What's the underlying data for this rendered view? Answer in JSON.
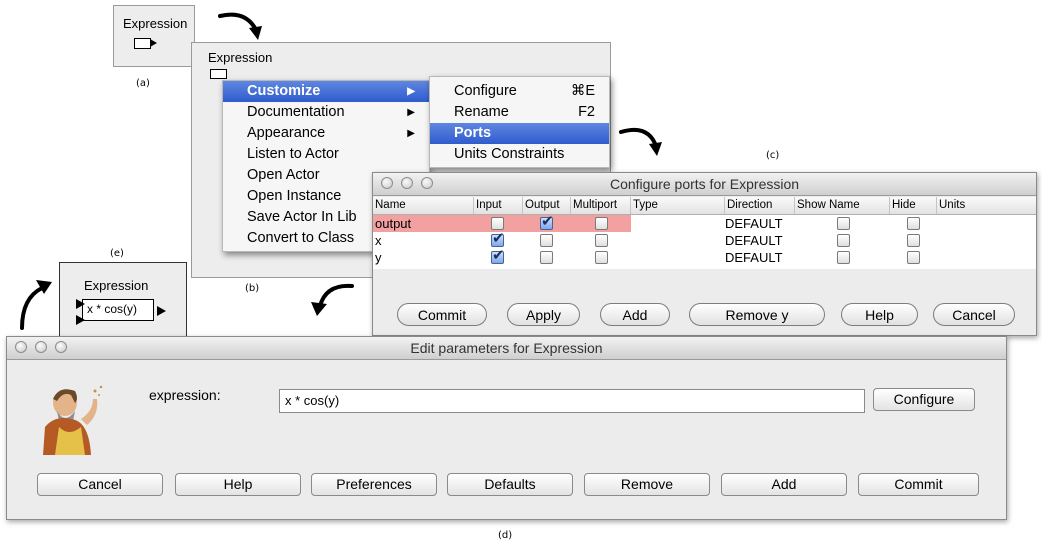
{
  "panel_a": {
    "title": "Expression",
    "caption": "(a)"
  },
  "panel_b": {
    "title": "Expression",
    "caption": "(b)",
    "menu": [
      {
        "label": "Customize",
        "submenu": true,
        "selected": true
      },
      {
        "label": "Documentation",
        "submenu": true
      },
      {
        "label": "Appearance",
        "submenu": true
      },
      {
        "label": "Listen to Actor"
      },
      {
        "label": "Open Actor"
      },
      {
        "label": "Open Instance"
      },
      {
        "label": "Save Actor In Lib"
      },
      {
        "label": "Convert to Class"
      }
    ],
    "submenu": [
      {
        "label": "Configure",
        "shortcut": "⌘E"
      },
      {
        "label": "Rename",
        "shortcut": "F2"
      },
      {
        "label": "Ports",
        "shortcut": "",
        "selected": true
      },
      {
        "label": "Units Constraints",
        "shortcut": ""
      }
    ]
  },
  "panel_c": {
    "caption": "(c)",
    "title": "Configure ports for Expression",
    "columns": [
      "Name",
      "Input",
      "Output",
      "Multiport",
      "Type",
      "Direction",
      "Show Name",
      "Hide",
      "Units"
    ],
    "rows": [
      {
        "name": "output",
        "input": false,
        "output": true,
        "multiport": false,
        "direction": "DEFAULT",
        "show_name": false,
        "hide": false,
        "highlight": true
      },
      {
        "name": "x",
        "input": true,
        "output": false,
        "multiport": false,
        "direction": "DEFAULT",
        "show_name": false,
        "hide": false
      },
      {
        "name": "y",
        "input": true,
        "output": false,
        "multiport": false,
        "direction": "DEFAULT",
        "show_name": false,
        "hide": false
      }
    ],
    "buttons": [
      "Commit",
      "Apply",
      "Add",
      "Remove y",
      "Help",
      "Cancel"
    ]
  },
  "panel_d": {
    "caption": "(d)",
    "title": "Edit parameters for Expression",
    "param_label": "expression:",
    "param_value": "x * cos(y)",
    "configure_label": "Configure",
    "buttons": [
      "Cancel",
      "Help",
      "Preferences",
      "Defaults",
      "Remove",
      "Add",
      "Commit"
    ]
  },
  "panel_e": {
    "caption": "(e)",
    "title": "Expression",
    "formula": "x * cos(y)"
  },
  "colors": {
    "menu_highlight": "#2f5ccd",
    "row_highlight": "#f2a0a0",
    "checkbox_on": "#7fa7ea"
  }
}
